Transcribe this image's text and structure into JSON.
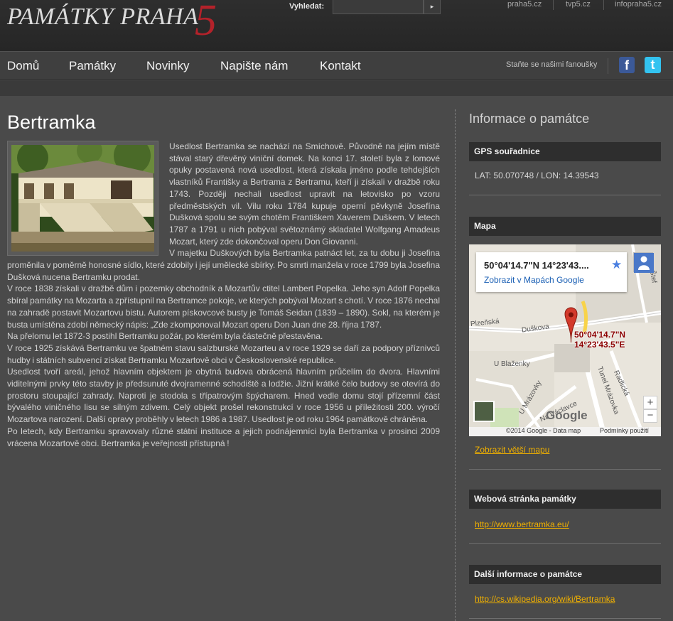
{
  "header": {
    "logo_text": "PAMÁTKY PRAHA",
    "logo_number": "5",
    "search_label": "Vyhledat:",
    "search_value": "",
    "search_button": "▸",
    "top_links": [
      "praha5.cz",
      "tvp5.cz",
      "infopraha5.cz"
    ]
  },
  "nav": {
    "items": [
      "Domů",
      "Památky",
      "Novinky",
      "Napište nám",
      "Kontakt"
    ],
    "fans_text": "Staňte se našimi fanoušky",
    "facebook_icon": "f",
    "twitter_icon": "t"
  },
  "main": {
    "title": "Bertramka",
    "paragraphs": [
      "Usedlost Bertramka se nachází na Smíchově. Původně na jejím místě stával starý dřevěný viniční domek. Na konci 17. století byla z lomové opuky postavená nová usedlost, která získala jméno podle tehdejších vlastníků Františky a Bertrama z Bertramu, kteří ji získali v dražbě roku 1743. Později nechali usedlost upravit na letovisko po vzoru předměstských vil. Vilu roku 1784 kupuje operní pěvkyně Josefína Dušková spolu se svým chotěm Františkem Xaverem Duškem. V letech 1787 a 1791 u nich pobýval světoznámý skladatel Wolfgang Amadeus Mozart, který zde dokončoval operu Don Giovanni.",
      "V majetku Duškových byla Bertramka patnáct let, za tu dobu ji Josefina proměnila v poměrně honosné sídlo, které zdobily i její umělecké sbírky. Po smrti manžela v roce 1799 byla Josefina Dušková nucena Bertramku prodat.",
      "V roce 1838 získali v dražbě dům i pozemky obchodník a Mozartův ctitel Lambert Popelka. Jeho syn Adolf Popelka sbíral památky na Mozarta a zpřístupnil na Bertramce pokoje, ve kterých pobýval Mozart s chotí. V roce 1876 nechal na zahradě postavit Mozartovu bistu. Autorem pískovcové busty je Tomáš Seidan (1839 – 1890). Sokl, na kterém je busta umístěna zdobí německý nápis: „Zde zkomponoval Mozart operu Don Juan dne 28. října 1787.",
      "Na přelomu let 1872-3 postihl Bertramku požár, po kterém byla částečně přestavěna.",
      "V roce 1925 získává Bertramku ve špatném stavu salzburské Mozarteu a v roce 1929 se daří za podpory příznivců hudby i státních subvencí získat Bertramku Mozartově obci v Československé republice.",
      "Usedlost tvoří areál, jehož hlavním objektem je obytná budova obrácená hlavním průčelím do dvora. Hlavními viditelnými prvky této stavby je předsunuté dvojramenné schodiště a lodžie. Jižní krátké čelo budovy se otevírá do prostoru stoupající zahrady. Naproti je stodola s třípatrovým špýcharem. Hned vedle domu stojí přízemní část bývalého viničného lisu se silným zdivem. Celý objekt prošel rekonstrukcí v roce 1956 u příležitosti 200. výročí Mozartova narození. Další opravy proběhly v letech 1986 a 1987. Usedlost je od roku 1964 památkově chráněna.",
      "Po letech, kdy Bertramku spravovaly různé státní instituce a jejich podnájemníci byla Bertramka v prosinci 2009 vrácena Mozartově obci. Bertramka je veřejnosti přístupná !"
    ]
  },
  "sidebar": {
    "title": "Informace o památce",
    "gps_head": "GPS souřadnice",
    "gps_value": "LAT: 50.070748 / LON: 14.39543",
    "map_head": "Mapa",
    "map": {
      "card_coords": "50°04'14.7\"N 14°23'43....",
      "card_link": "Zobrazit v Mapách Google",
      "pin_label_line1": "50°04'14.7\"N",
      "pin_label_line2": "14°23'43.5\"E",
      "zoom_in": "+",
      "zoom_out": "−",
      "google": "Google",
      "copyright": "©2014 Google - Data map",
      "terms": "Podmínky použití",
      "streets": [
        "Plzeňská",
        "Duškova",
        "U Blaženky",
        "U Mrázovky",
        "Na Václavce",
        "Radlická",
        "Tunel Mrázovka",
        "Štef"
      ]
    },
    "bigger_map_link": "Zobrazit větší mapu",
    "web_head": "Webová stránka památky",
    "web_link": "http://www.bertramka.eu/",
    "more_head": "Další informace o památce",
    "more_link": "http://cs.wikipedia.org/wiki/Bertramka"
  },
  "colors": {
    "background": "#4a4a4a",
    "accent_red": "#b3222a",
    "link_yellow": "#f0b000",
    "sidebar_head": "#2e2e2e"
  }
}
